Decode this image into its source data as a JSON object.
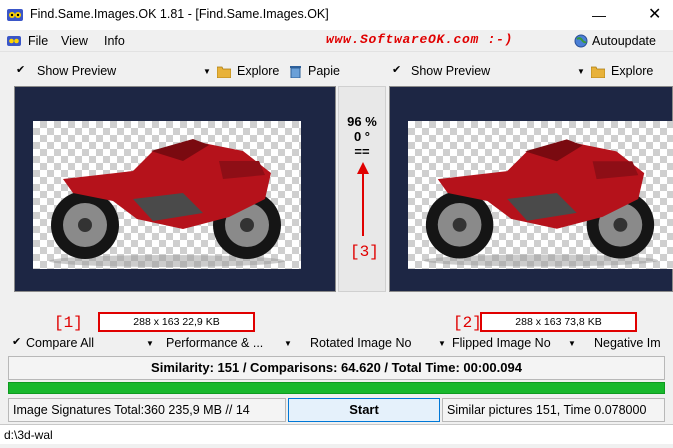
{
  "window": {
    "title": "Find.Same.Images.OK 1.81 - [Find.Same.Images.OK]",
    "minimize_glyph": "—",
    "close_glyph": "✕"
  },
  "menu": {
    "items": [
      "File",
      "View",
      "Info"
    ],
    "website": "www.SoftwareOK.com :-)",
    "autoupdate": "Autoupdate"
  },
  "left_pane": {
    "show_preview": "Show Preview",
    "explore": "Explore",
    "trash": "Papie",
    "info": "288 x 163 22,9 KB",
    "annotation": "[1]"
  },
  "right_pane": {
    "show_preview": "Show Preview",
    "explore": "Explore",
    "info": "288 x 163 73,8 KB",
    "annotation": "[2]"
  },
  "center": {
    "similarity_pct": "96 %",
    "rotation": "0 °",
    "equal_sign": "==",
    "annotation": "[3]"
  },
  "options": {
    "compare_all": "Compare All",
    "performance": "Performance & ...",
    "rotated": "Rotated Image No",
    "flipped": "Flipped Image No",
    "negative": "Negative Im"
  },
  "similarity_line": "Similarity: 151 / Comparisons: 64.620 / Total Time: 00:00.094",
  "progress_fraction": 1.0,
  "status": {
    "signatures": "Image Signatures Total:360  235,9 MB // 14",
    "start_label": "Start",
    "similar": "Similar pictures 151, Time 0.078000"
  },
  "path": "d:\\3d-wal",
  "colors": {
    "accent_red": "#e00000",
    "progress_green": "#18b82c",
    "image_bg": "#1d2644",
    "bike_red": "#b5121b"
  },
  "icons": [
    "app-icon",
    "globe-icon",
    "checkmark-icon",
    "dropdown-arrow-icon",
    "explore-icon",
    "trash-icon",
    "red-arrow-icon"
  ]
}
